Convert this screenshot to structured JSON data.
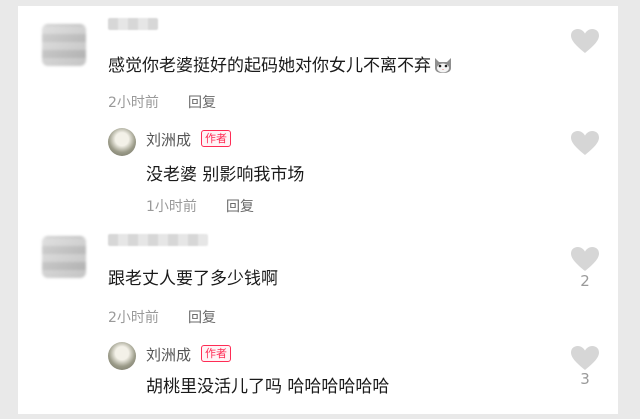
{
  "comments": [
    {
      "text": "感觉你老婆挺好的起码她对你女儿不离不弃",
      "emoji_icon": "cat-emoji-icon",
      "time": "2小时前",
      "reply_label": "回复",
      "like_count": "",
      "reply": {
        "author": "刘洲成",
        "badge": "作者",
        "text": "没老婆 别影响我市场",
        "time": "1小时前",
        "reply_label": "回复",
        "like_count": ""
      }
    },
    {
      "text": "跟老丈人要了多少钱啊",
      "time": "2小时前",
      "reply_label": "回复",
      "like_count": "2",
      "reply": {
        "author": "刘洲成",
        "badge": "作者",
        "text": "胡桃里没活儿了吗 哈哈哈哈哈哈",
        "time": "",
        "reply_label": "",
        "like_count": "3"
      }
    }
  ],
  "colors": {
    "badge": "#fe2c55",
    "heart": "#d6d6d6",
    "meta": "#9a9a9a",
    "background": "#e9e9e9"
  }
}
